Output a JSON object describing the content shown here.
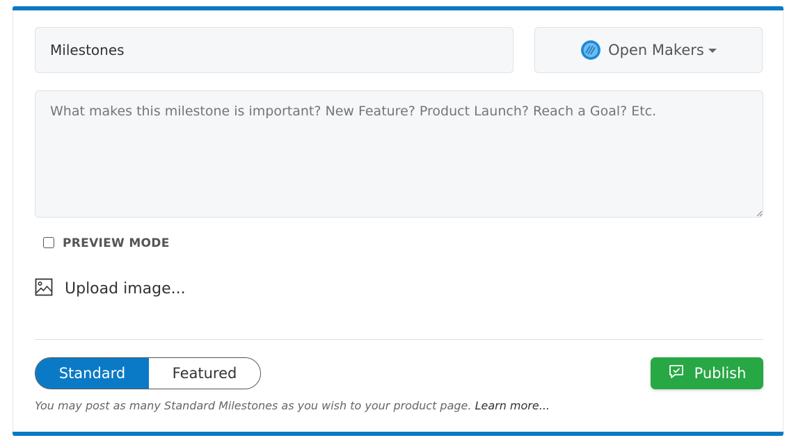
{
  "form": {
    "title_value": "Milestones",
    "product": {
      "name": "Open Makers",
      "logo_icon": "open-makers-logo-icon"
    },
    "description_placeholder": "What makes this milestone is important? New Feature? Product Launch? Reach a Goal? Etc.",
    "preview_mode_label": "PREVIEW MODE",
    "preview_mode_checked": false,
    "upload_label": "Upload image...",
    "upload_icon": "image-icon"
  },
  "footer": {
    "type_options": [
      "Standard",
      "Featured"
    ],
    "selected_type": "Standard",
    "publish_label": "Publish",
    "publish_icon": "comment-check-icon",
    "note_text": "You may post as many Standard Milestones as you wish to your product page.",
    "learn_more_label": "Learn more..."
  },
  "colors": {
    "accent": "#0a7ac6",
    "publish": "#28a745",
    "field_bg": "#f6f7f9"
  }
}
